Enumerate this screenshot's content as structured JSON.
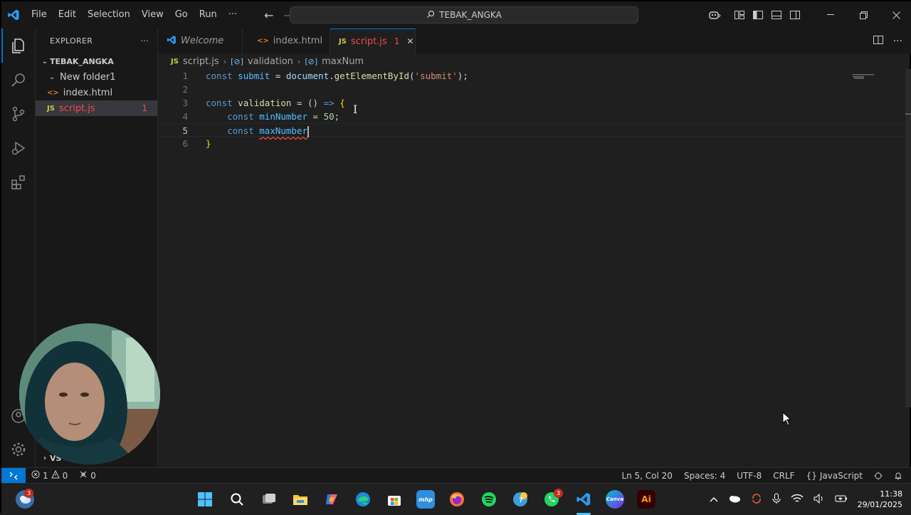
{
  "titlebar": {
    "menu": [
      "File",
      "Edit",
      "Selection",
      "View",
      "Go",
      "Run",
      "···"
    ],
    "search_text": "TEBAK_ANGKA"
  },
  "sidebar": {
    "header": "EXPLORER",
    "more": "···",
    "folder": "TEBAK_ANGKA",
    "items": [
      {
        "label": "New folder1",
        "type": "folder"
      },
      {
        "label": "index.html",
        "type": "html"
      },
      {
        "label": "script.js",
        "type": "js",
        "problems": "1"
      }
    ],
    "collapsed_label": "VS"
  },
  "tabs": [
    {
      "label": "Welcome",
      "icon": "vscode-icon"
    },
    {
      "label": "index.html",
      "icon": "html-icon"
    },
    {
      "label": "script.js",
      "icon": "js-icon",
      "problems": "1",
      "close": "✕"
    }
  ],
  "breadcrumb": {
    "file_icon": "JS",
    "file": "script.js",
    "symbol1_icon": "[⊘]",
    "symbol1": "validation",
    "symbol2_icon": "[⊘]",
    "symbol2": "maxNum"
  },
  "editor": {
    "active_line": 5,
    "lines": [
      {
        "n": "1",
        "tokens": [
          [
            "kw",
            "const"
          ],
          [
            "op",
            " "
          ],
          [
            "var",
            "submit"
          ],
          [
            "op",
            " = "
          ],
          [
            "obj",
            "document"
          ],
          [
            "op",
            "."
          ],
          [
            "fn",
            "getElementById"
          ],
          [
            "op",
            "("
          ],
          [
            "str",
            "'submit'"
          ],
          [
            "op",
            ");"
          ]
        ]
      },
      {
        "n": "2",
        "tokens": []
      },
      {
        "n": "3",
        "tokens": [
          [
            "kw",
            "const"
          ],
          [
            "op",
            " "
          ],
          [
            "fn",
            "validation"
          ],
          [
            "op",
            " = () "
          ],
          [
            "kw",
            "=>"
          ],
          [
            "op",
            " "
          ],
          [
            "brace",
            "{"
          ]
        ]
      },
      {
        "n": "4",
        "tokens": [
          [
            "op",
            "    "
          ],
          [
            "kw",
            "const"
          ],
          [
            "op",
            " "
          ],
          [
            "var",
            "minNumber"
          ],
          [
            "op",
            " = "
          ],
          [
            "num",
            "50"
          ],
          [
            "op",
            ";"
          ]
        ]
      },
      {
        "n": "5",
        "tokens": [
          [
            "op",
            "    "
          ],
          [
            "kw",
            "const"
          ],
          [
            "op",
            " "
          ],
          [
            "var squiggle",
            "maxNumber"
          ]
        ]
      },
      {
        "n": "6",
        "tokens": [
          [
            "brace",
            "}"
          ]
        ]
      }
    ]
  },
  "statusbar": {
    "errors": "1",
    "warnings": "0",
    "ports": "0",
    "position": "Ln 5, Col 20",
    "spaces": "Spaces: 4",
    "encoding": "UTF-8",
    "eol": "CRLF",
    "language_icon": "{}",
    "language": "JavaScript"
  },
  "taskbar": {
    "weather_badge": "3",
    "whatsapp_badge": "3",
    "mhp_label": "mhp",
    "canva_label": "Canva",
    "ai_label": "Ai",
    "time": "11:38",
    "date": "29/01/2025"
  }
}
